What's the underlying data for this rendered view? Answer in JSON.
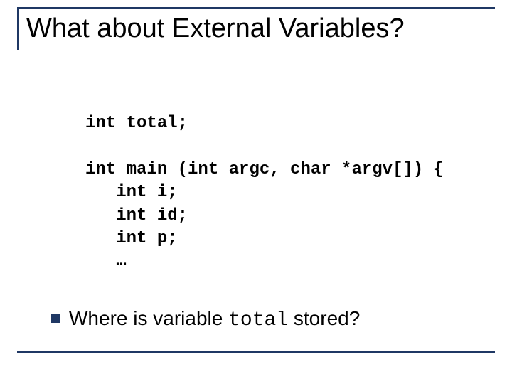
{
  "slide": {
    "title": "What about External Variables?",
    "code": {
      "line1": "int total;",
      "line2": "",
      "line3": "int main (int argc, char *argv[]) {",
      "line4": "   int i;",
      "line5": "   int id;",
      "line6": "   int p;",
      "line7": "   …"
    },
    "bullet": {
      "prefix": "Where is variable ",
      "code_word": "total",
      "suffix": " stored?"
    }
  }
}
